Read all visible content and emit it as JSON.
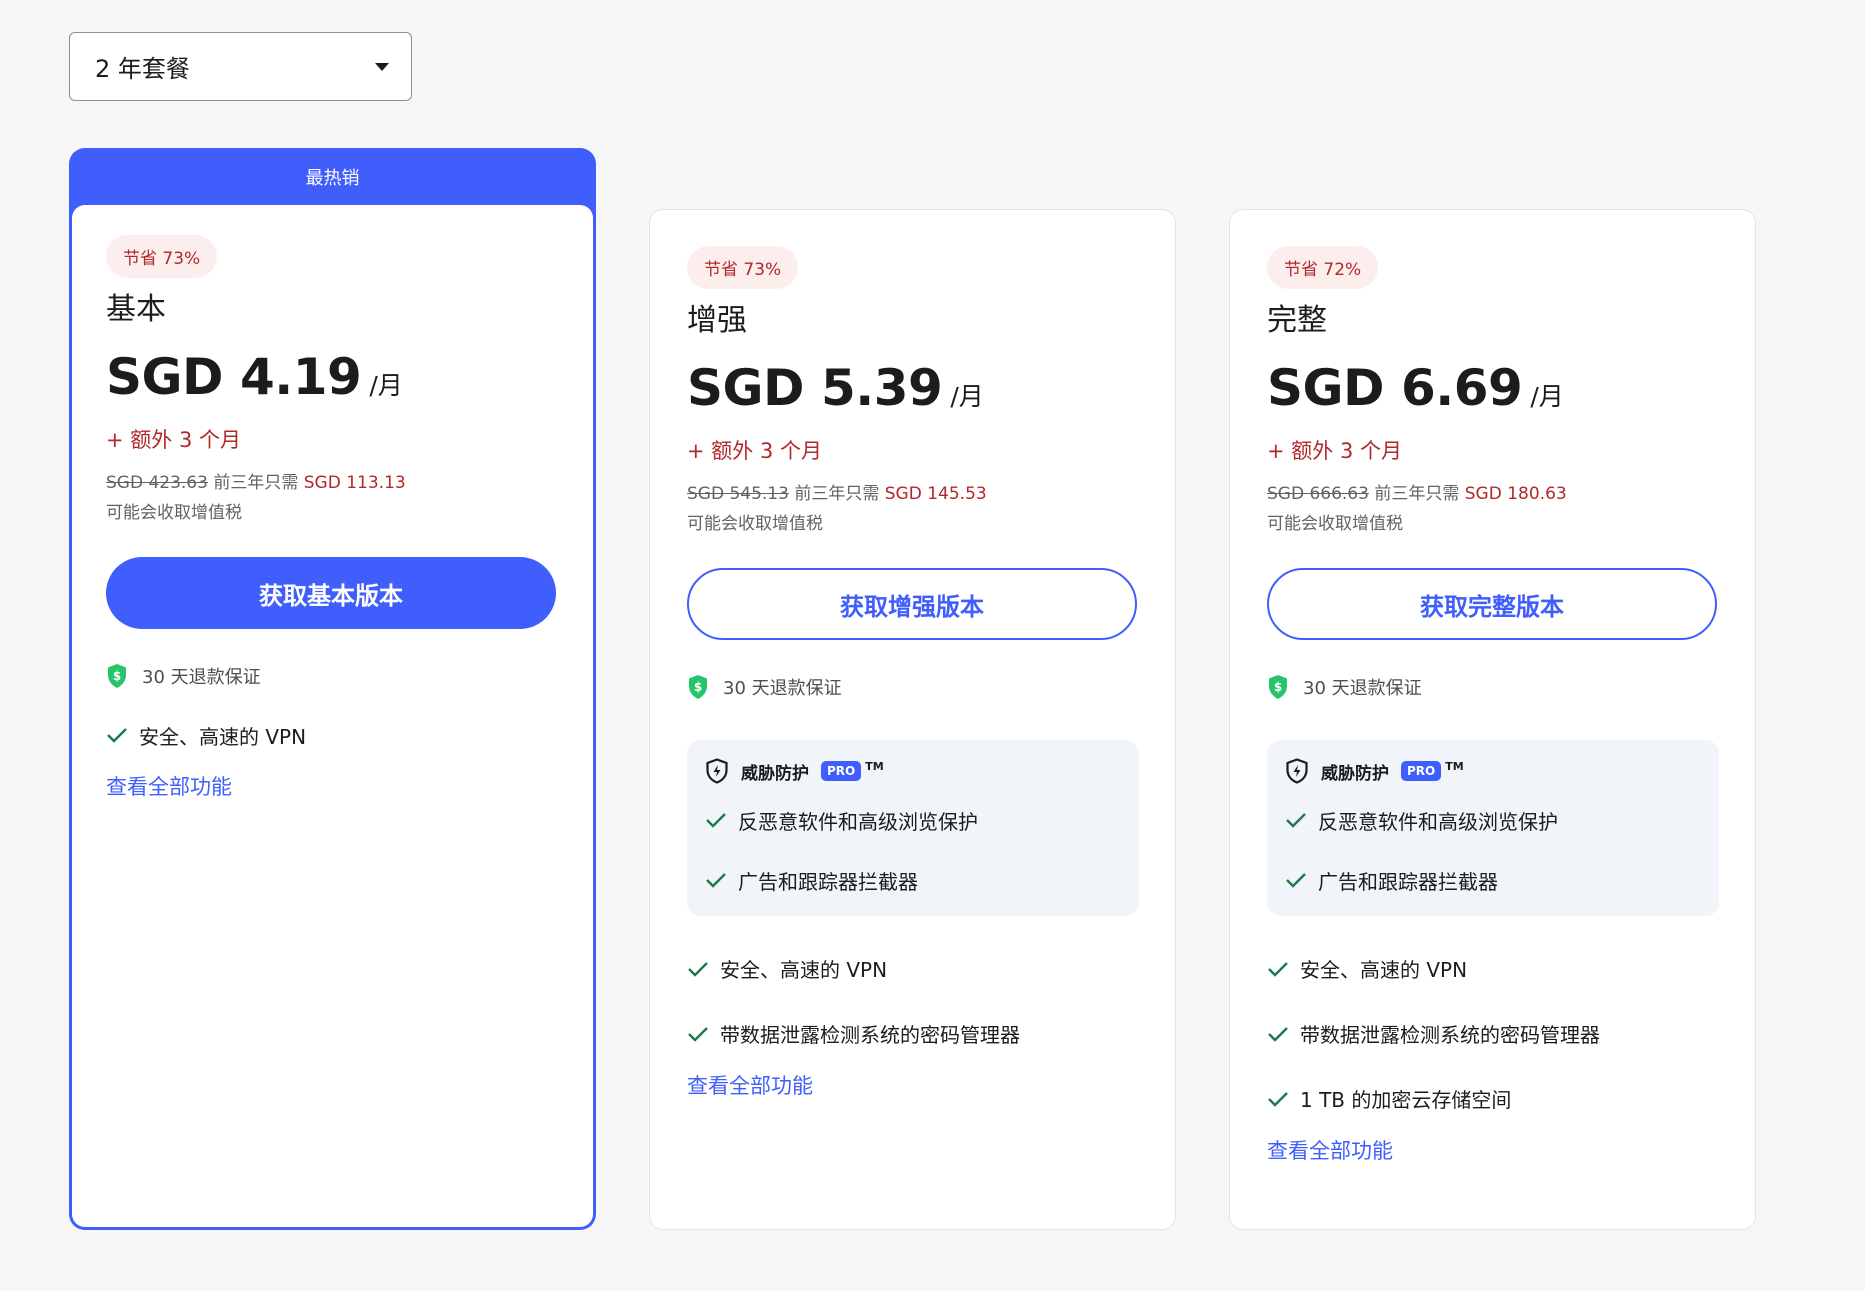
{
  "plan_selector": {
    "selected": "2 年套餐"
  },
  "colors": {
    "accent": "#3f5efb",
    "sale_red": "#b0282a",
    "check_green": "#1d7a4b",
    "shield_green": "#27c46a"
  },
  "cards": [
    {
      "featured_label": "最热销",
      "badge": "节省 73%",
      "tier": "基本",
      "price": "SGD 4.19",
      "per": "/月",
      "bonus": "+ 额外 3 个月",
      "old_price": "SGD 423.63",
      "old_suffix": " 前三年只需 ",
      "new_price": "SGD 113.13",
      "vat": "可能会收取增值税",
      "cta": "获取基本版本",
      "guarantee": "30 天退款保证",
      "features": [
        "安全、高速的 VPN"
      ],
      "all_link": "查看全部功能"
    },
    {
      "badge": "节省 73%",
      "tier": "增强",
      "price": "SGD 5.39",
      "per": "/月",
      "bonus": "+ 额外 3 个月",
      "old_price": "SGD 545.13",
      "old_suffix": " 前三年只需 ",
      "new_price": "SGD 145.53",
      "vat": "可能会收取增值税",
      "cta": "获取增强版本",
      "guarantee": "30 天退款保证",
      "threat": {
        "title": "威胁防护",
        "pro": "PRO",
        "tm": "TM",
        "items": [
          "反恶意软件和高级浏览保护",
          "广告和跟踪器拦截器"
        ]
      },
      "features": [
        "安全、高速的 VPN",
        "带数据泄露检测系统的密码管理器"
      ],
      "all_link": "查看全部功能"
    },
    {
      "badge": "节省 72%",
      "tier": "完整",
      "price": "SGD 6.69",
      "per": "/月",
      "bonus": "+ 额外 3 个月",
      "old_price": "SGD 666.63",
      "old_suffix": " 前三年只需 ",
      "new_price": "SGD 180.63",
      "vat": "可能会收取增值税",
      "cta": "获取完整版本",
      "guarantee": "30 天退款保证",
      "threat": {
        "title": "威胁防护",
        "pro": "PRO",
        "tm": "TM",
        "items": [
          "反恶意软件和高级浏览保护",
          "广告和跟踪器拦截器"
        ]
      },
      "features": [
        "安全、高速的 VPN",
        "带数据泄露检测系统的密码管理器",
        "1 TB 的加密云存储空间"
      ],
      "all_link": "查看全部功能"
    }
  ]
}
